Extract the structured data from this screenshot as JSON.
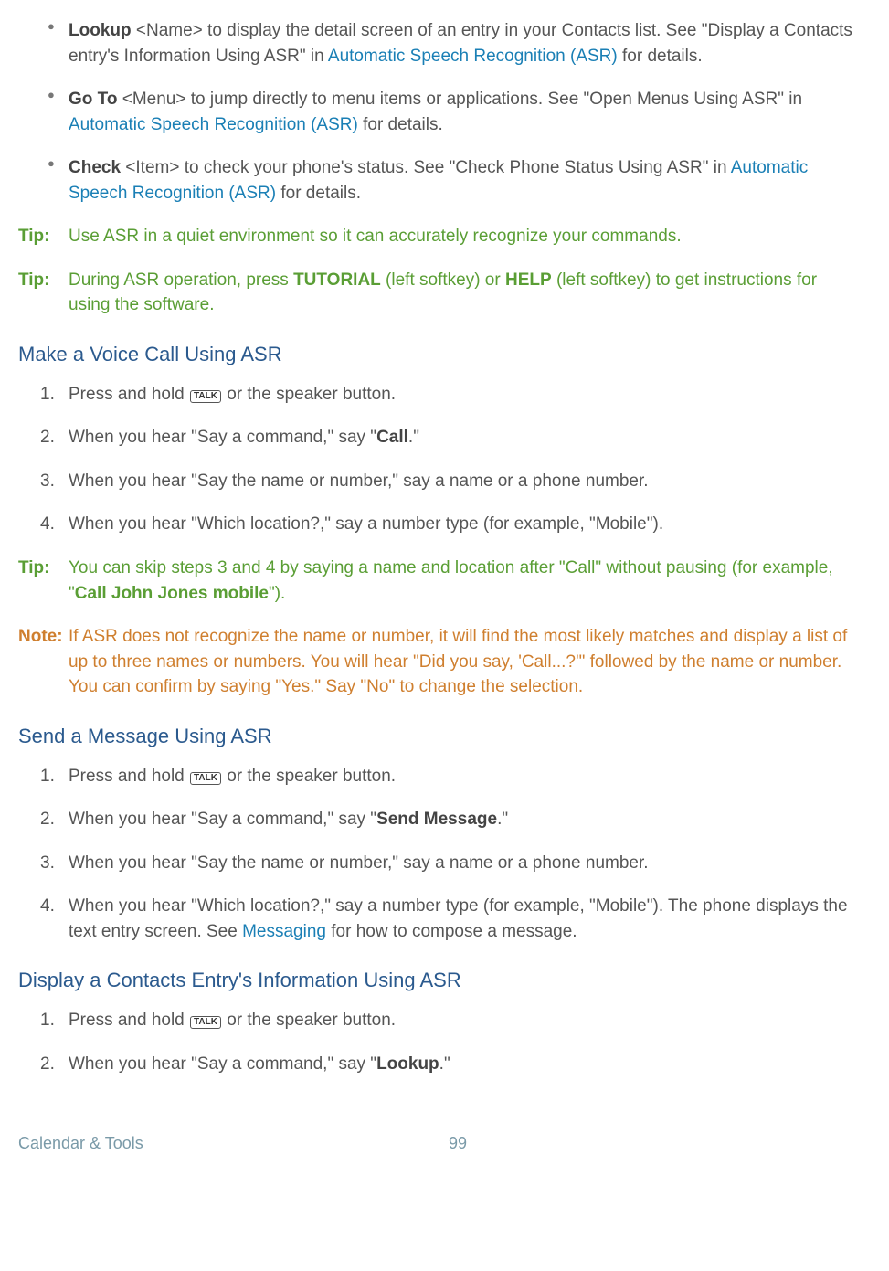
{
  "bullets": {
    "b1": {
      "cmd": "Lookup",
      "arg": " <Name> to display the detail screen of an entry in your Contacts list. See \"Display a Contacts entry's Information Using ASR\" in ",
      "link": "Automatic Speech Recognition (ASR)",
      "tail": " for details."
    },
    "b2": {
      "cmd": "Go To",
      "arg": " <Menu> to jump directly to menu items or applications. See \"Open Menus Using ASR\" in ",
      "link": "Automatic Speech Recognition (ASR)",
      "tail": " for details."
    },
    "b3": {
      "cmd": "Check",
      "arg": " <Item> to check your phone's status. See \"Check Phone Status Using ASR\" in ",
      "link": "Automatic Speech Recognition (ASR)",
      "tail": " for details."
    }
  },
  "tip1": {
    "label": "Tip:",
    "text": "Use ASR in a quiet environment so it can accurately recognize your commands."
  },
  "tip2": {
    "label": "Tip:",
    "a": "During ASR operation, press ",
    "b": "TUTORIAL",
    "c": " (left softkey) or ",
    "d": "HELP",
    "e": " (left softkey) to get instructions for using the software."
  },
  "tip3": {
    "label": "Tip:",
    "a": "You can skip steps 3 and 4 by saying a name and location after \"Call\" without pausing (for example, \"",
    "b": "Call John Jones mobile",
    "c": "\")."
  },
  "note1": {
    "label": "Note:",
    "text": "If ASR does not recognize the name or number, it will find the most likely matches and display a list of up to three names or numbers. You will hear \"Did you say, 'Call...?'\" followed by the name or number. You can confirm by saying \"Yes.\" Say \"No\" to change the selection."
  },
  "labels": {
    "talk": "TALK"
  },
  "sec1": {
    "title": "Make a Voice Call Using ASR",
    "s1a": "Press and hold ",
    "s1b": " or the speaker button.",
    "s2a": "When you hear \"Say a command,\" say \"",
    "s2b": "Call",
    "s2c": ".\"",
    "s3": "When you hear \"Say the name or number,\" say a name or a phone number.",
    "s4": "When you hear \"Which location?,\" say a number type (for example, \"Mobile\")."
  },
  "sec2": {
    "title": "Send a Message Using ASR",
    "s1a": "Press and hold ",
    "s1b": " or the speaker button.",
    "s2a": "When you hear \"Say a command,\" say \"",
    "s2b": "Send Message",
    "s2c": ".\"",
    "s3": "When you hear \"Say the name or number,\" say a name or a phone number.",
    "s4a": "When you hear \"Which location?,\" say a number type (for example, \"Mobile\"). The phone displays the text entry screen. See ",
    "s4link": "Messaging",
    "s4b": " for how to compose a message."
  },
  "sec3": {
    "title": "Display a Contacts Entry's Information Using ASR",
    "s1a": "Press and hold ",
    "s1b": " or the speaker button.",
    "s2a": "When you hear \"Say a command,\" say \"",
    "s2b": "Lookup",
    "s2c": ".\""
  },
  "footer": {
    "section": "Calendar & Tools",
    "page": "99"
  }
}
